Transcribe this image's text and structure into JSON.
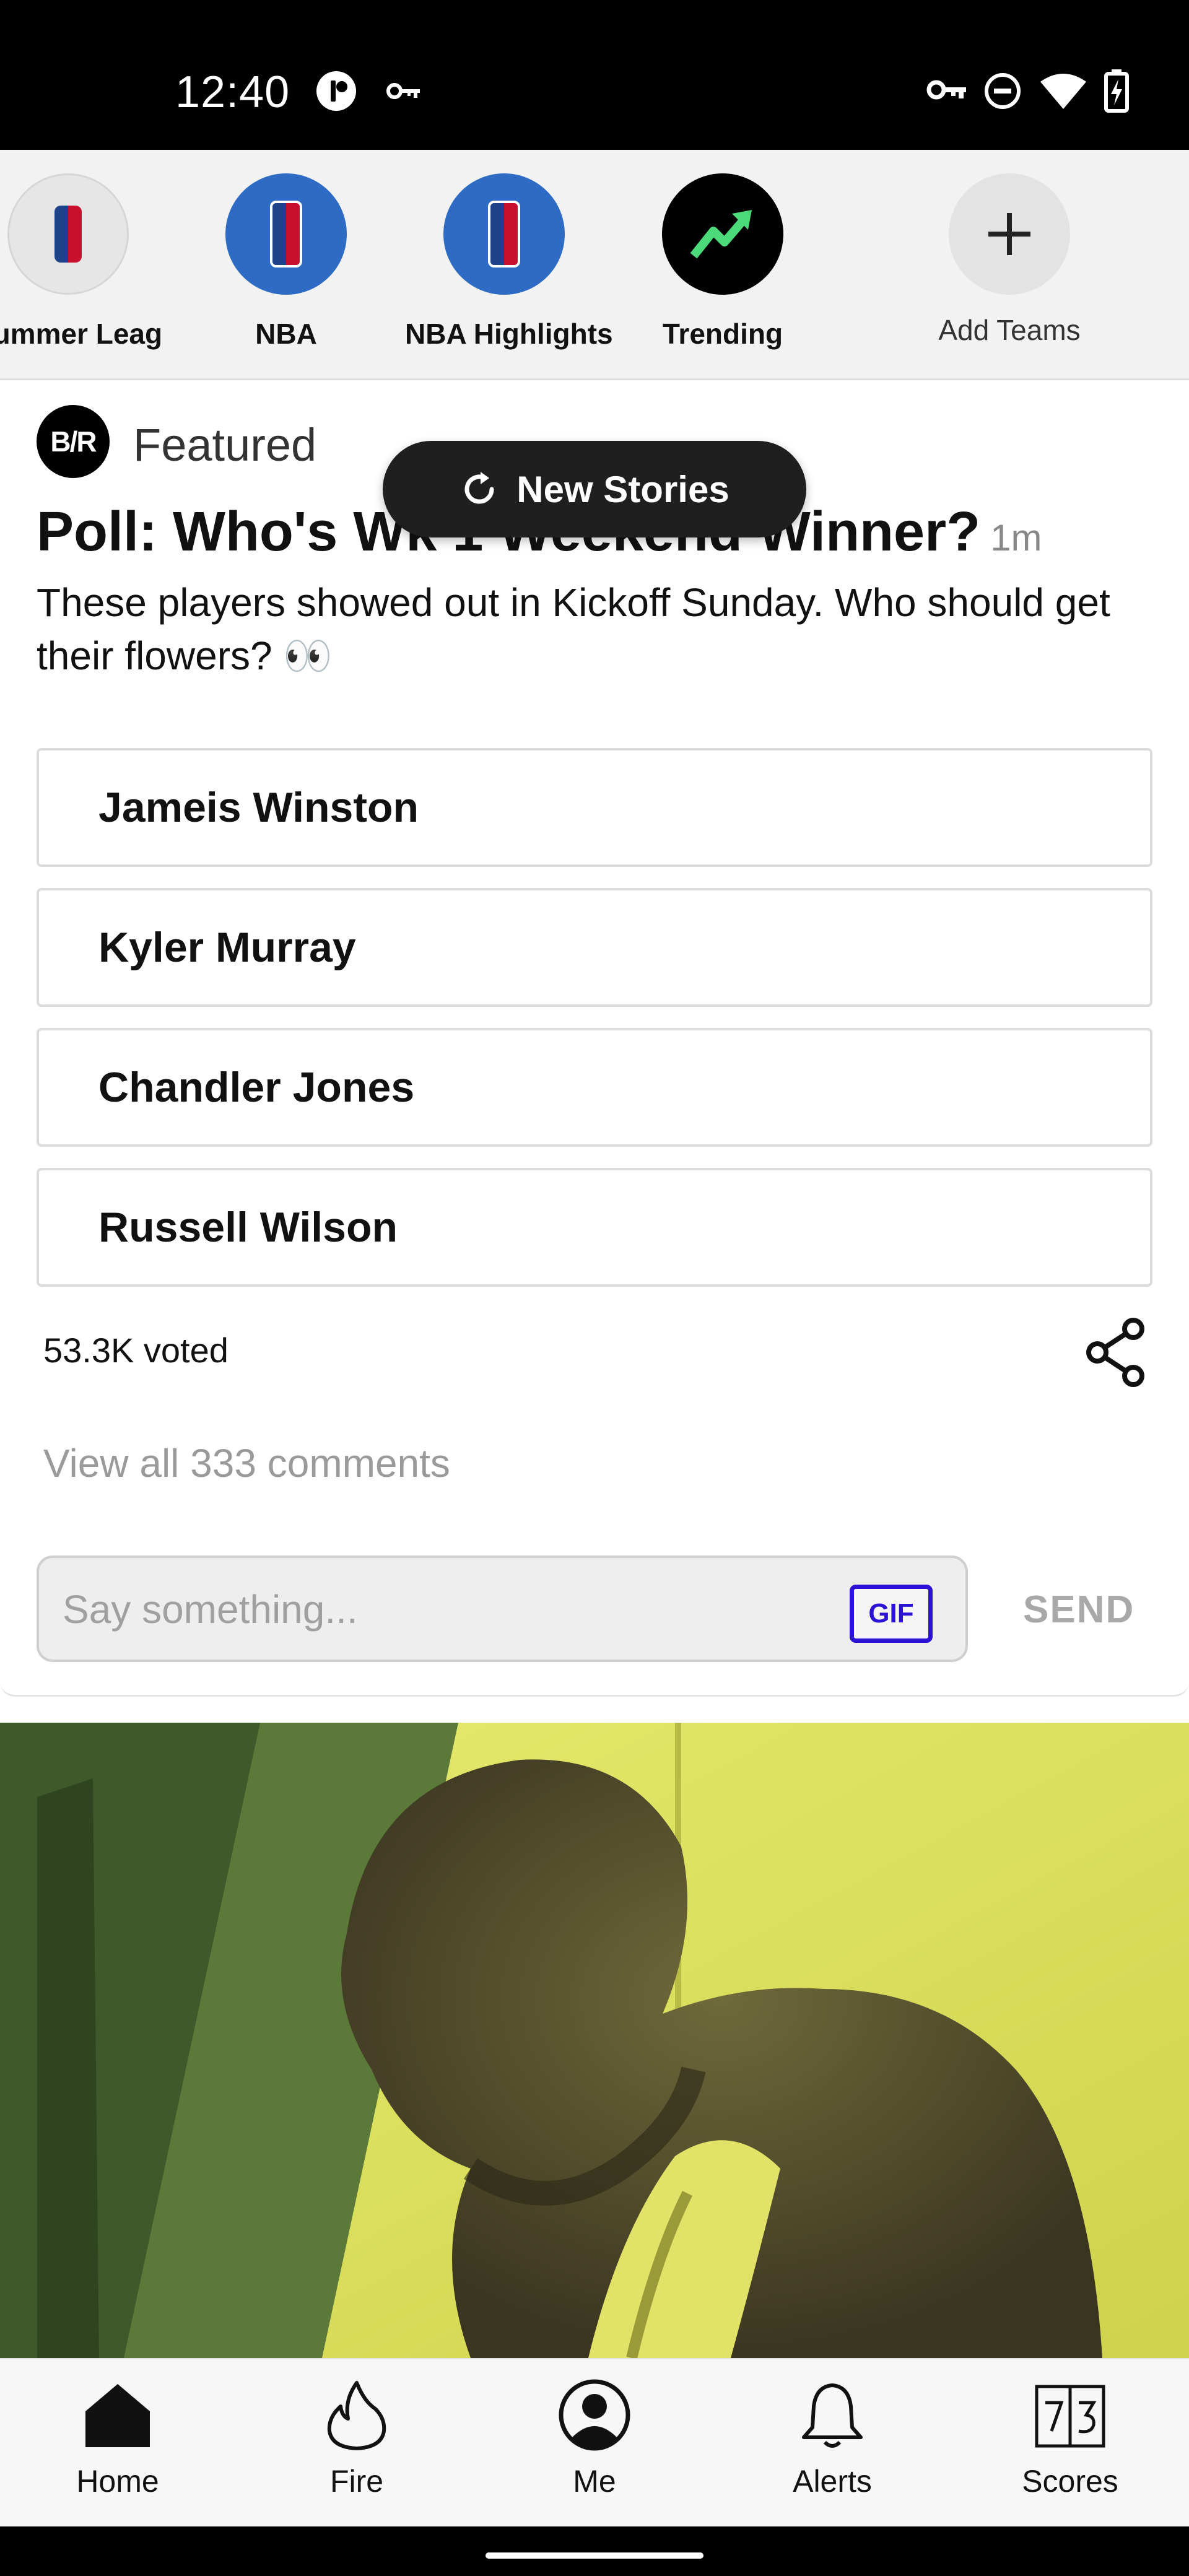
{
  "status_bar": {
    "time": "12:40",
    "left_icons": [
      "app-badge-icon",
      "vpn-key-icon"
    ],
    "right_icons": [
      "vpn-key-icon",
      "do-not-disturb-icon",
      "wifi-icon",
      "battery-charging-icon"
    ]
  },
  "teams": {
    "items": [
      {
        "label": "Summer Leag",
        "icon": "nba-logo-icon"
      },
      {
        "label": "NBA",
        "icon": "nba-logo-icon"
      },
      {
        "label": "NBA Highlights",
        "icon": "nba-logo-icon"
      },
      {
        "label": "Trending",
        "icon": "trending-icon"
      },
      {
        "label": "Add Teams",
        "icon": "plus-icon"
      }
    ]
  },
  "featured": {
    "source_logo": "B/R",
    "label": "Featured",
    "new_stories": "New Stories",
    "poll_title": "Poll: Who's Wk 1 Weekend Winner?",
    "poll_time": "1m",
    "poll_desc": "These players showed out in Kickoff Sunday. Who should get their flowers? 👀",
    "options": [
      "Jameis Winston",
      "Kyler Murray",
      "Chandler Jones",
      "Russell Wilson"
    ],
    "votes": "53.3K voted",
    "view_comments": "View all 333 comments",
    "comment_placeholder": "Say something...",
    "gif_label": "GIF",
    "send_label": "SEND"
  },
  "bottom_nav": {
    "items": [
      {
        "label": "Home",
        "icon": "home-icon"
      },
      {
        "label": "Fire",
        "icon": "fire-icon"
      },
      {
        "label": "Me",
        "icon": "profile-icon"
      },
      {
        "label": "Alerts",
        "icon": "bell-icon"
      },
      {
        "label": "Scores",
        "icon": "scores-icon"
      }
    ]
  },
  "colors": {
    "nba_blue": "#2d6bc4",
    "gif_accent": "#2b12d6",
    "trending_green": "#4cd97a"
  }
}
